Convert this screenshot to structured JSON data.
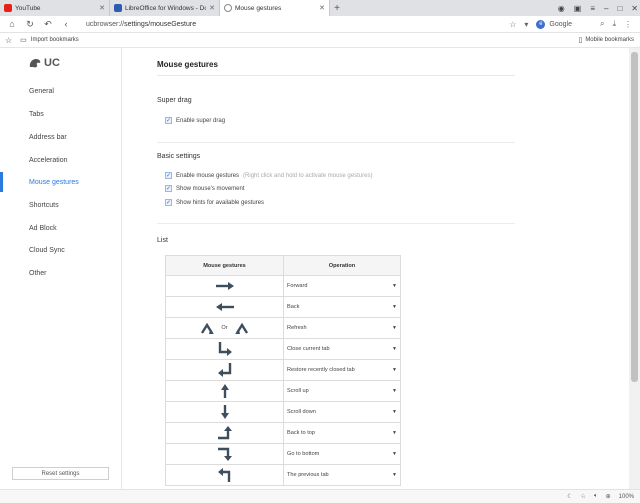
{
  "tabs": [
    {
      "label": "YouTube",
      "fav_color": "#e62117",
      "active": false
    },
    {
      "label": "LibreOffice for Windows - Do",
      "fav_color": "#2f5bb0",
      "active": false
    },
    {
      "label": "Mouse gestures",
      "fav_color": "#888888",
      "active": true
    }
  ],
  "address": {
    "scheme": "ucbrowser://",
    "path": "settings/mouseGesture"
  },
  "search_engine": "Google",
  "bookmarks": {
    "import": "Import bookmarks",
    "mobile": "Mobile bookmarks"
  },
  "logo": "UC",
  "sidebar": {
    "items": [
      {
        "label": "General"
      },
      {
        "label": "Tabs"
      },
      {
        "label": "Address bar"
      },
      {
        "label": "Acceleration"
      },
      {
        "label": "Mouse gestures"
      },
      {
        "label": "Shortcuts"
      },
      {
        "label": "Ad Block"
      },
      {
        "label": "Cloud Sync"
      },
      {
        "label": "Other"
      }
    ],
    "reset": "Reset settings"
  },
  "main": {
    "title": "Mouse gestures",
    "super_drag": {
      "heading": "Super drag",
      "enable": "Enable super drag"
    },
    "basic": {
      "heading": "Basic settings",
      "enable_gestures": "Enable mouse gestures",
      "enable_hint": "(Right click and hold to activate mouse gestures)",
      "show_movement": "Show mouse's movement",
      "show_hints": "Show hints for available gestures"
    },
    "list": {
      "heading": "List",
      "col_gesture": "Mouse gestures",
      "col_operation": "Operation",
      "or_text": "Or",
      "rows": [
        {
          "gesture": "right-arrow-icon",
          "operation": "Forward"
        },
        {
          "gesture": "left-arrow-icon",
          "operation": "Back"
        },
        {
          "gesture": "up-down-gesture-icon",
          "operation": "Refresh"
        },
        {
          "gesture": "down-right-gesture-icon",
          "operation": "Close current tab"
        },
        {
          "gesture": "right-up-left-gesture-icon",
          "operation": "Restore recently closed tab"
        },
        {
          "gesture": "up-arrow-icon",
          "operation": "Scroll up"
        },
        {
          "gesture": "down-arrow-icon",
          "operation": "Scroll down"
        },
        {
          "gesture": "left-up-gesture-icon",
          "operation": "Back to top"
        },
        {
          "gesture": "right-down-gesture-icon",
          "operation": "Go to bottom"
        },
        {
          "gesture": "up-left-gesture-icon",
          "operation": "The previous tab"
        }
      ]
    }
  },
  "status": {
    "zoom": "100%"
  },
  "colors": {
    "accent": "#2a7bde",
    "arrow": "#3d4f5e"
  }
}
